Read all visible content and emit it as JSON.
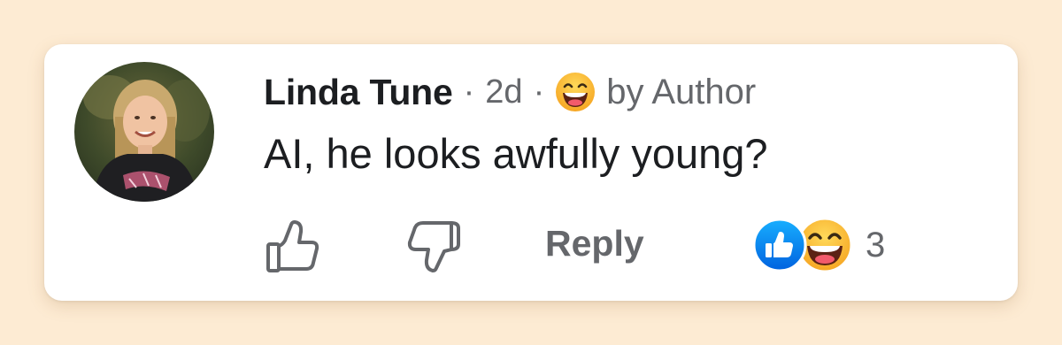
{
  "comment": {
    "author": "Linda Tune",
    "separator": "·",
    "time": "2d",
    "reaction_badge_icon": "haha-emoji-icon",
    "badge_text": "by Author",
    "text": "AI, he looks awfully young?"
  },
  "actions": {
    "like_icon": "thumbs-up-icon",
    "dislike_icon": "thumbs-down-icon",
    "reply_label": "Reply",
    "reaction_icons": [
      "like-reaction-icon",
      "haha-reaction-icon"
    ],
    "reaction_count": "3"
  },
  "colors": {
    "background": "#fdebd3",
    "card": "#ffffff",
    "primary_text": "#1c1e21",
    "secondary_text": "#65676b",
    "like_blue": "#1877f2",
    "haha_yellow": "#f7b125"
  }
}
